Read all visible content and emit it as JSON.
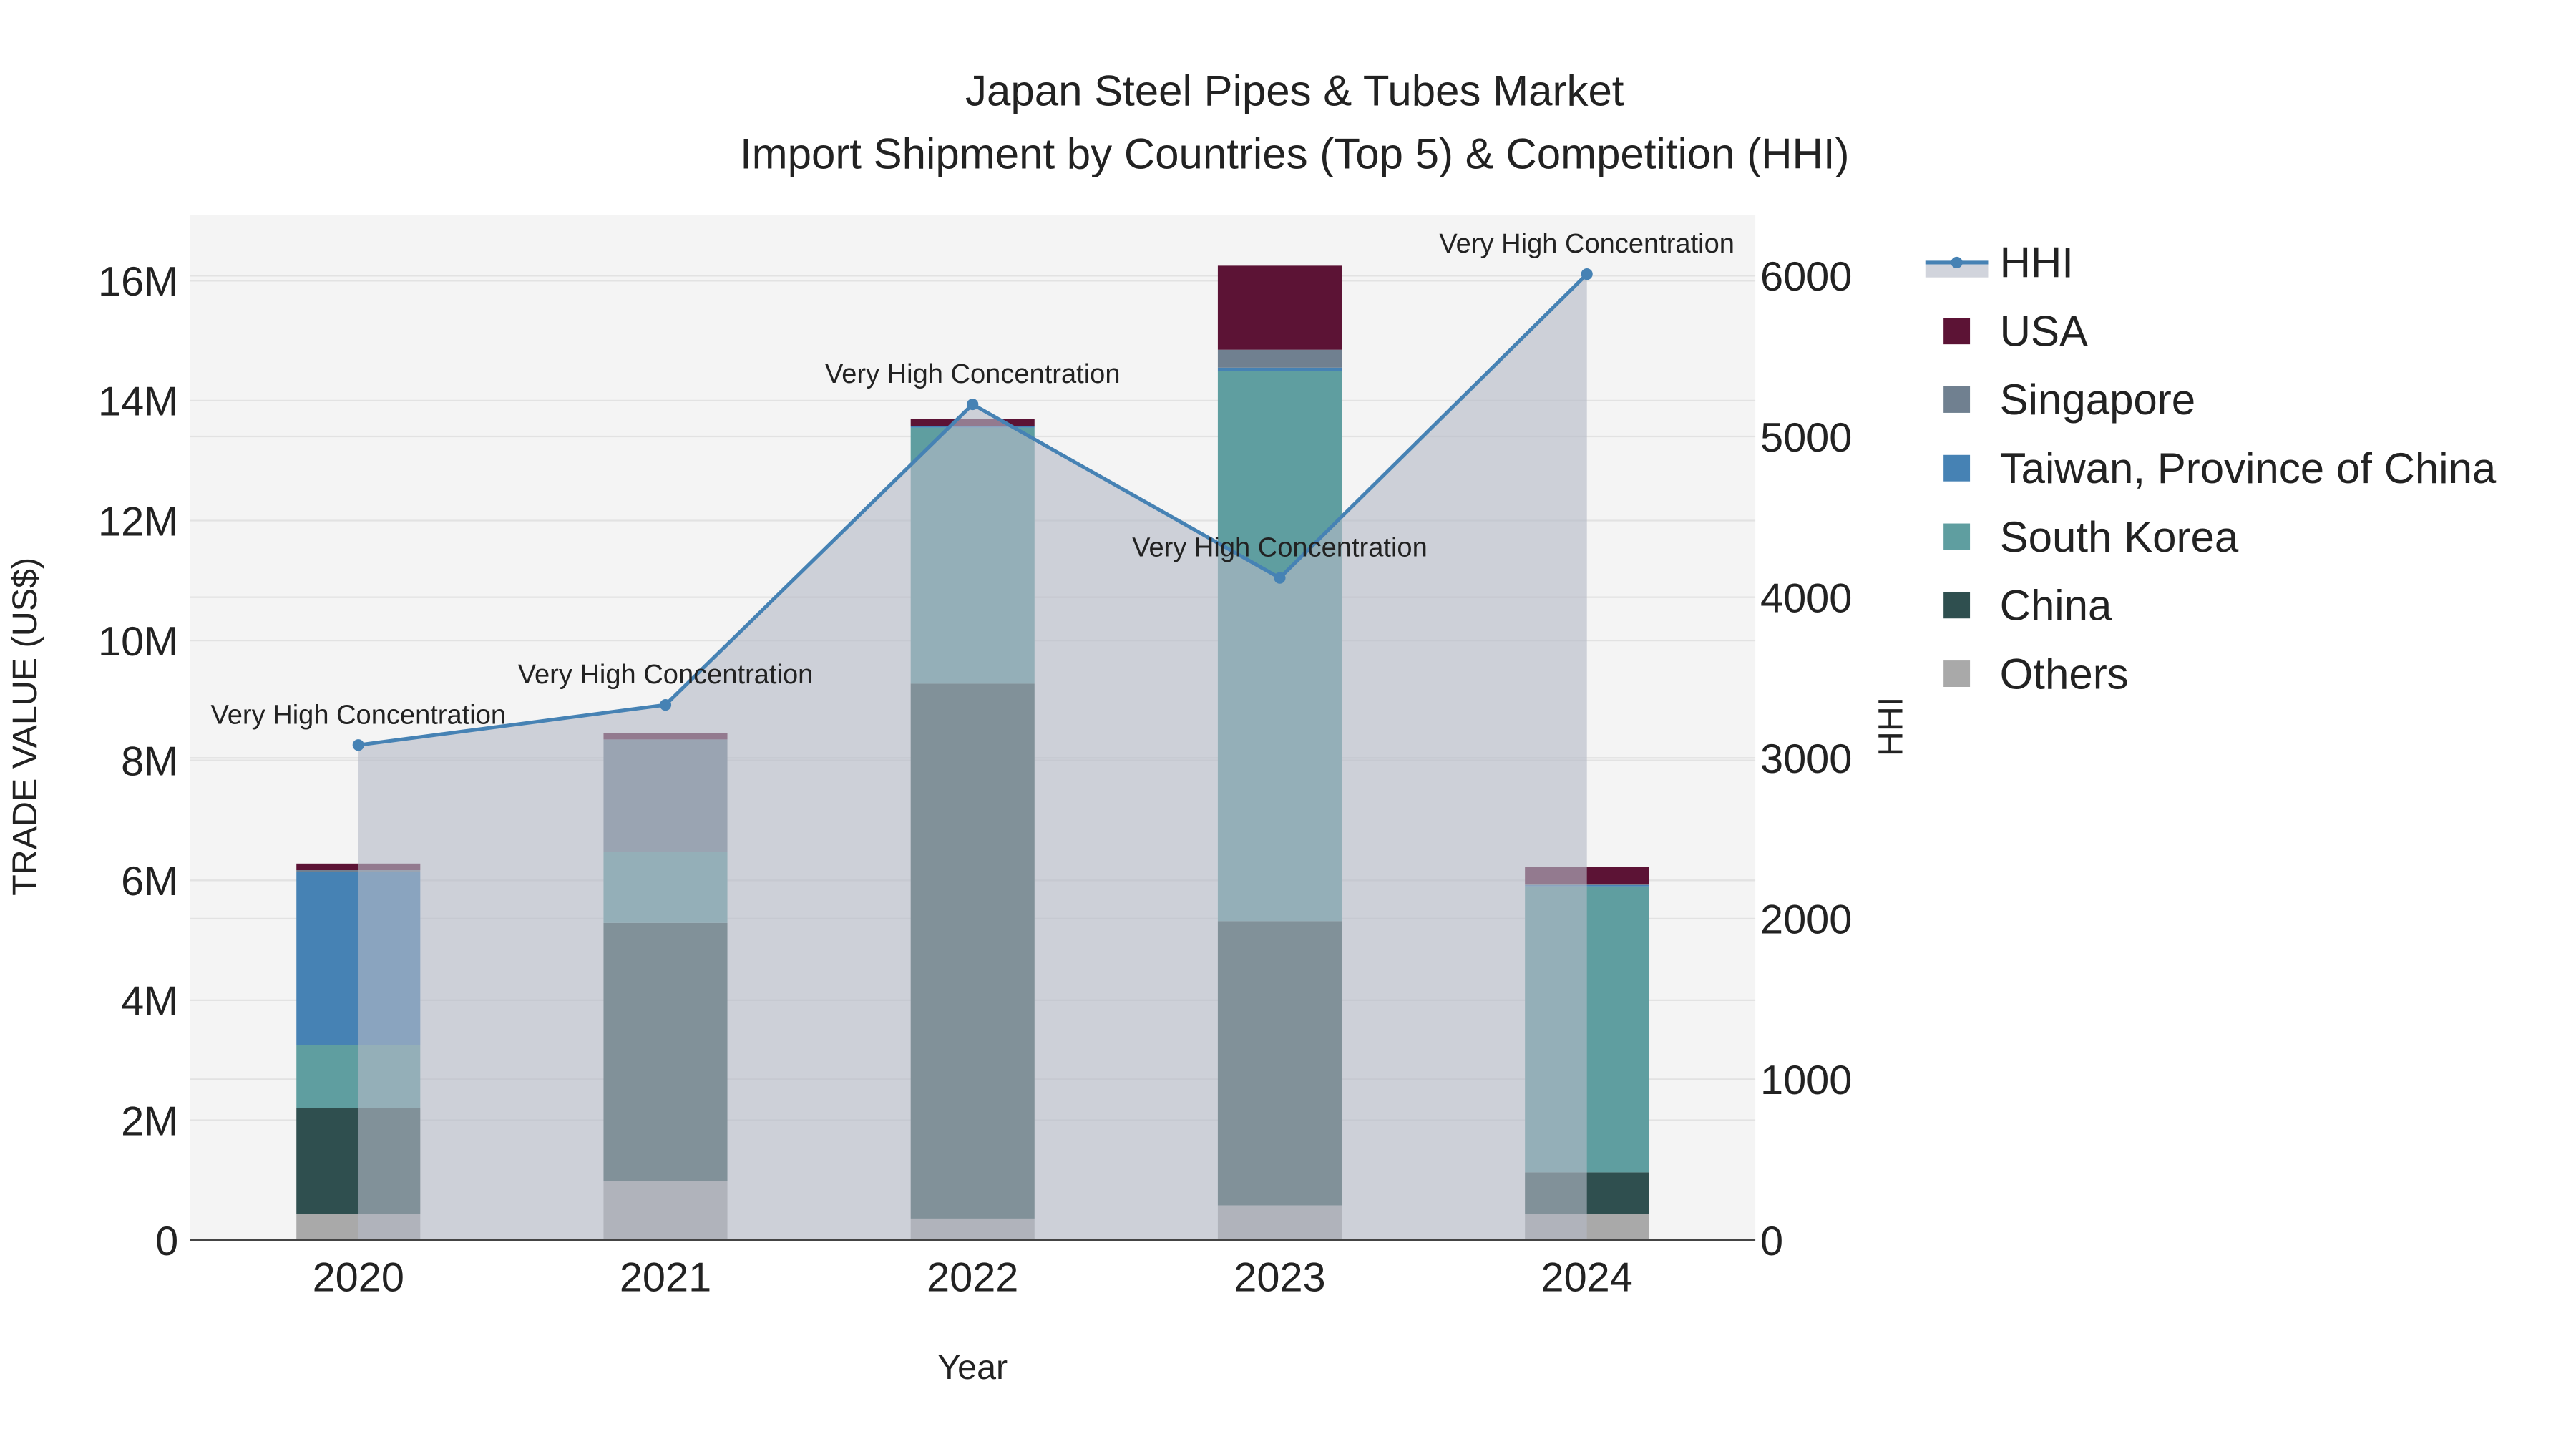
{
  "chart_data": {
    "type": "bar",
    "title_line1": "Japan Steel Pipes & Tubes Market",
    "title_line2": "Import Shipment by Countries (Top 5) & Competition (HHI)",
    "xlabel": "Year",
    "ylabel": "TRADE VALUE (US$)",
    "y2label": "HHI",
    "categories": [
      "2020",
      "2021",
      "2022",
      "2023",
      "2024"
    ],
    "ylim": [
      0,
      17000000
    ],
    "y2lim": [
      0,
      6400
    ],
    "yticks": [
      {
        "v": 0,
        "label": "0"
      },
      {
        "v": 2000000,
        "label": "2M"
      },
      {
        "v": 4000000,
        "label": "4M"
      },
      {
        "v": 6000000,
        "label": "6M"
      },
      {
        "v": 8000000,
        "label": "8M"
      },
      {
        "v": 10000000,
        "label": "10M"
      },
      {
        "v": 12000000,
        "label": "12M"
      },
      {
        "v": 14000000,
        "label": "14M"
      },
      {
        "v": 16000000,
        "label": "16M"
      }
    ],
    "y2ticks": [
      {
        "v": 0,
        "label": "0"
      },
      {
        "v": 1000,
        "label": "1000"
      },
      {
        "v": 2000,
        "label": "2000"
      },
      {
        "v": 3000,
        "label": "3000"
      },
      {
        "v": 4000,
        "label": "4000"
      },
      {
        "v": 5000,
        "label": "5000"
      },
      {
        "v": 6000,
        "label": "6000"
      }
    ],
    "series": [
      {
        "name": "Others",
        "color": "#a9a9a9",
        "values": [
          440000,
          990000,
          360000,
          580000,
          440000
        ]
      },
      {
        "name": "China",
        "color": "#2f4f4f",
        "values": [
          1760000,
          4300000,
          8920000,
          4740000,
          690000
        ]
      },
      {
        "name": "South Korea",
        "color": "#5f9ea0",
        "values": [
          1050000,
          1180000,
          4270000,
          9170000,
          4770000
        ]
      },
      {
        "name": "Taiwan, Province of China",
        "color": "#4682b4",
        "values": [
          2890000,
          10000,
          20000,
          60000,
          20000
        ]
      },
      {
        "name": "Singapore",
        "color": "#708090",
        "values": [
          30000,
          1870000,
          10000,
          300000,
          10000
        ]
      },
      {
        "name": "USA",
        "color": "#5c1335",
        "values": [
          110000,
          110000,
          110000,
          1400000,
          300000
        ]
      }
    ],
    "hhi": {
      "name": "HHI",
      "color": "#4682b4",
      "values": [
        3080,
        3330,
        5200,
        4120,
        6010
      ],
      "annotations": [
        "Very High Concentration",
        "Very High Concentration",
        "Very High Concentration",
        "Very High Concentration",
        "Very High Concentration"
      ]
    },
    "legend_order": [
      "HHI",
      "USA",
      "Singapore",
      "Taiwan, Province of China",
      "South Korea",
      "China",
      "Others"
    ],
    "legend_position": "right",
    "grid": true
  }
}
